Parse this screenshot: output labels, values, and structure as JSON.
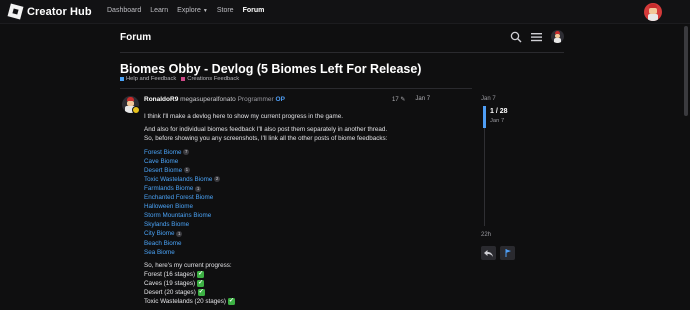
{
  "nav": {
    "brand": "Creator Hub",
    "links": [
      {
        "label": "Dashboard"
      },
      {
        "label": "Learn"
      },
      {
        "label": "Explore"
      },
      {
        "label": "Store"
      },
      {
        "label": "Forum"
      }
    ]
  },
  "forum": {
    "title": "Forum"
  },
  "topic": {
    "title": "Biomes Obby - Devlog (5 Biomes Left For Release)",
    "tags": [
      {
        "label": "Help and Feedback",
        "color": "#4aa3f7"
      },
      {
        "label": "Creations Feedback",
        "color": "#d04a8a"
      }
    ]
  },
  "post": {
    "username": "RonaldoR9",
    "fullname": "megasuperalfonato",
    "role": "Programmer",
    "op": "OP",
    "edits": "17",
    "date": "Jan 7",
    "intro": "I think I'll make a devlog here to show my current progress in the game.",
    "para2": "And also for individual biomes feedback I'll also post them separately in another thread.",
    "para3": "So, before showing you any screenshots, I'll link all the other posts of biome feedbacks:",
    "biomes": [
      {
        "name": "Forest Biome",
        "count": "7"
      },
      {
        "name": "Cave Biome",
        "count": ""
      },
      {
        "name": "Desert Biome",
        "count": "1"
      },
      {
        "name": "Toxic Wastelands Biome",
        "count": "2"
      },
      {
        "name": "Farmlands Biome",
        "count": "1"
      },
      {
        "name": "Enchanted Forest Biome",
        "count": ""
      },
      {
        "name": "Halloween Biome",
        "count": ""
      },
      {
        "name": "Storm Mountains Biome",
        "count": ""
      },
      {
        "name": "Skylands Biome",
        "count": ""
      },
      {
        "name": "City Biome",
        "count": "1"
      },
      {
        "name": "Beach Biome",
        "count": ""
      },
      {
        "name": "Sea Biome",
        "count": ""
      }
    ],
    "progress_heading": "So, here's my current progress:",
    "progress": [
      {
        "label": "Forest (16 stages)"
      },
      {
        "label": "Caves (19 stages)"
      },
      {
        "label": "Desert (20 stages)"
      },
      {
        "label": "Toxic Wastelands (20 stages)"
      }
    ]
  },
  "timeline": {
    "start": "Jan 7",
    "position": "1 / 28",
    "current_date": "Jan 7",
    "end": "22h",
    "progress_fraction": 0.036
  },
  "colors": {
    "accent": "#4f9ef5",
    "link": "#4aa3f7",
    "background": "#0f0f10",
    "check": "#3cb043"
  },
  "icons": [
    "roblox-logo-icon",
    "search-icon",
    "menu-icon",
    "avatar",
    "reply-icon",
    "flag-icon"
  ]
}
